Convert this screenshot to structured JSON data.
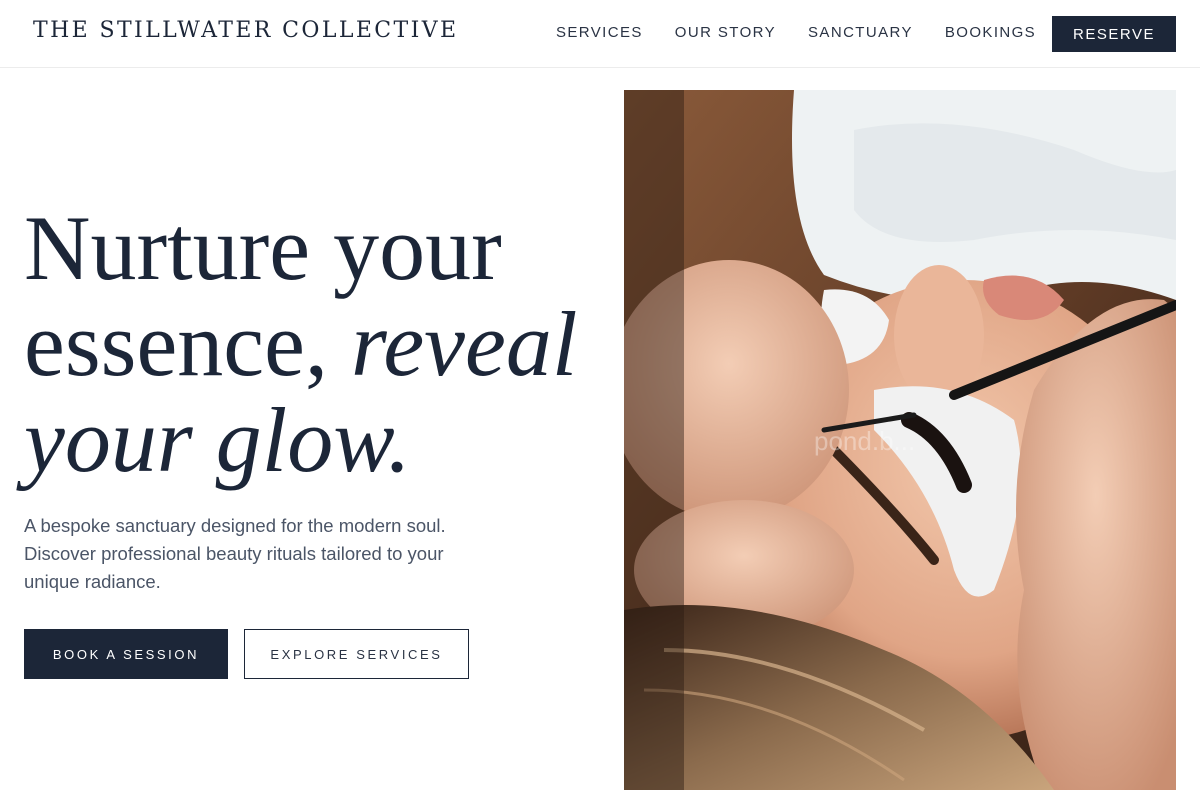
{
  "header": {
    "brand": "THE STILLWATER COLLECTIVE",
    "nav": [
      "SERVICES",
      "OUR STORY",
      "SANCTUARY",
      "BOOKINGS"
    ],
    "cta": "RESERVE"
  },
  "hero": {
    "headline_line1": "Nurture your",
    "headline_line2_regular": "essence,",
    "headline_line2_italic": "reveal",
    "headline_line3_italic": "your glow.",
    "subcopy": "A bespoke sanctuary designed for the modern soul. Discover professional beauty rituals tailored to your unique radiance.",
    "primary_button": "BOOK A SESSION",
    "secondary_button": "EXPLORE SERVICES"
  },
  "image": {
    "watermark": "pond.b..."
  },
  "colors": {
    "navy": "#1c2638",
    "body_text": "#4b5567",
    "background": "#ffffff"
  }
}
